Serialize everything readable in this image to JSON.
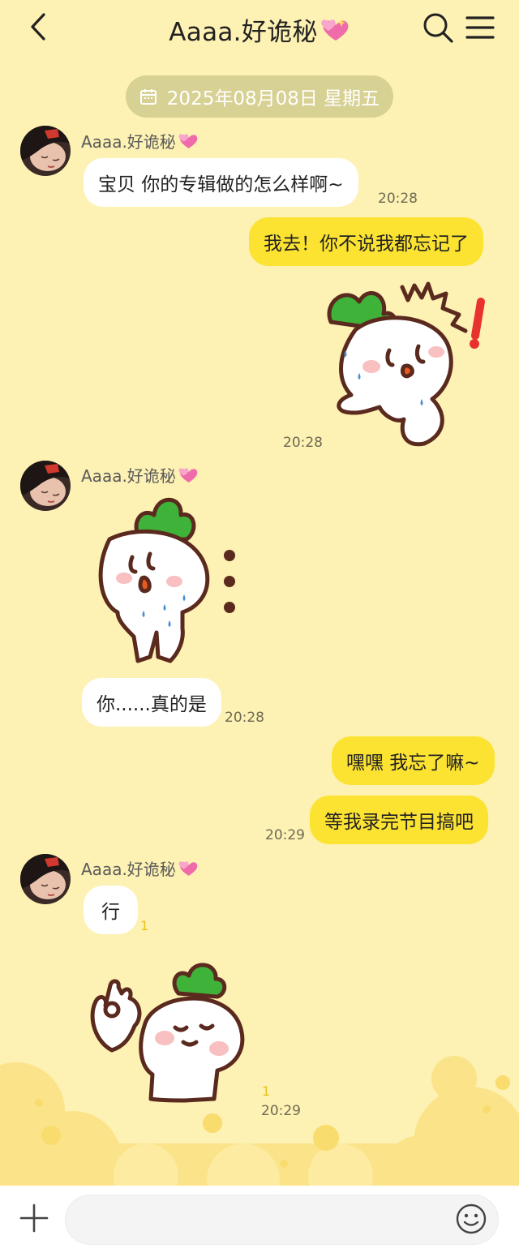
{
  "header": {
    "title": "Aaaa.好诡秘",
    "back_icon": "chevron-left-icon",
    "search_icon": "search-icon",
    "menu_icon": "hamburger-menu-icon"
  },
  "date_divider": {
    "icon": "calendar-icon",
    "text": "2025年08月08日 星期五"
  },
  "contact": {
    "name": "Aaaa.好诡秘",
    "name_decoration": "pink-hearts-emoji"
  },
  "messages": [
    {
      "from": "contact",
      "type": "text",
      "text": "宝贝 你的专辑做的怎么样啊~",
      "time": "20:28"
    },
    {
      "from": "me",
      "type": "text",
      "text": "我去！你不说我都忘记了"
    },
    {
      "from": "me",
      "type": "sticker",
      "sticker": "radish-shocked-sticker",
      "time": "20:28"
    },
    {
      "from": "contact",
      "type": "sticker",
      "sticker": "radish-crying-ellipsis-sticker"
    },
    {
      "from": "contact",
      "type": "text",
      "text": "你......真的是",
      "time": "20:28"
    },
    {
      "from": "me",
      "type": "text",
      "text": "嘿嘿 我忘了嘛~"
    },
    {
      "from": "me",
      "type": "text",
      "text": "等我录完节目搞吧",
      "time": "20:29"
    },
    {
      "from": "contact",
      "type": "text",
      "text": "行",
      "unread": "1"
    },
    {
      "from": "contact",
      "type": "sticker",
      "sticker": "radish-ok-gesture-sticker",
      "unread": "1",
      "time": "20:29"
    }
  ],
  "input_bar": {
    "plus_icon": "plus-icon",
    "placeholder": "",
    "emoji_icon": "emoji-smile-icon"
  },
  "colors": {
    "background": "#FDF1B3",
    "my_bubble": "#FCE332",
    "their_bubble": "#FFFFFF",
    "date_pill": "#D8D194",
    "radish_leaf": "#3FB23A",
    "outline": "#5A2A1E"
  }
}
